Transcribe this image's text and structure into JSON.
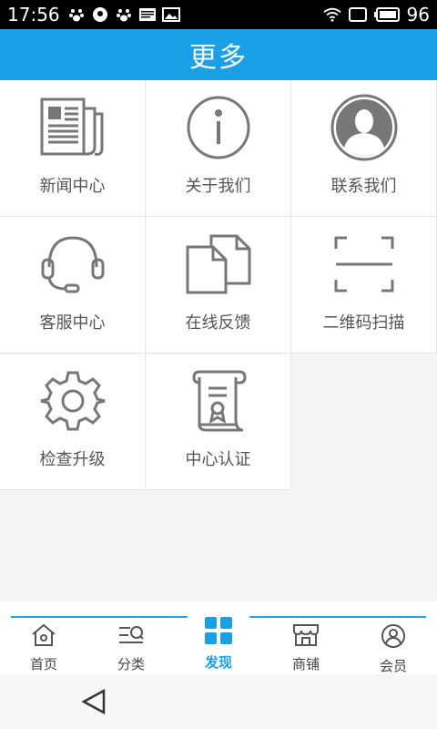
{
  "status_bar": {
    "time": "17:56",
    "battery": "96",
    "left_icons": [
      "paw-icon",
      "location-icon",
      "paw-icon",
      "news-icon",
      "image-icon"
    ],
    "right_icons": [
      "wifi-icon",
      "screen-icon",
      "battery-icon"
    ]
  },
  "header": {
    "title": "更多"
  },
  "grid": {
    "items": [
      {
        "label": "新闻中心",
        "icon": "newspaper-icon"
      },
      {
        "label": "关于我们",
        "icon": "info-icon"
      },
      {
        "label": "联系我们",
        "icon": "contact-person-icon"
      },
      {
        "label": "客服中心",
        "icon": "headset-icon"
      },
      {
        "label": "在线反馈",
        "icon": "documents-icon"
      },
      {
        "label": "二维码扫描",
        "icon": "scan-icon"
      },
      {
        "label": "检查升级",
        "icon": "gear-icon"
      },
      {
        "label": "中心认证",
        "icon": "certificate-scroll-icon"
      }
    ]
  },
  "tab_bar": {
    "tabs": [
      {
        "label": "首页",
        "icon": "home-icon"
      },
      {
        "label": "分类",
        "icon": "category-icon"
      },
      {
        "label": "发现",
        "icon": "discover-grid-icon",
        "active": true
      },
      {
        "label": "商铺",
        "icon": "shop-icon"
      },
      {
        "label": "会员",
        "icon": "member-icon"
      }
    ],
    "accent_color": "#1aa0e6"
  },
  "navigation": {
    "back_icon": "back-triangle-icon"
  }
}
